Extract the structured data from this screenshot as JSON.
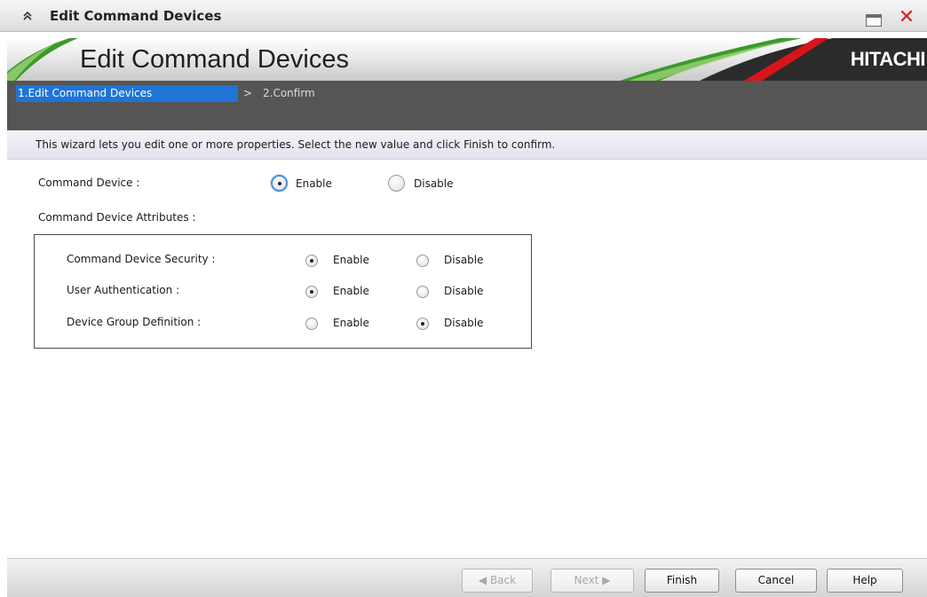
{
  "window": {
    "title": "Edit Command Devices"
  },
  "banner": {
    "title": "Edit Command Devices",
    "logo": "HITACHI"
  },
  "steps": {
    "current": "1.Edit Command Devices",
    "separator": ">",
    "next": "2.Confirm"
  },
  "description": "This wizard lets you edit one or more properties. Select the new value and click Finish to confirm.",
  "command_device": {
    "label": "Command Device :",
    "enable_label": "Enable",
    "disable_label": "Disable",
    "selected": "Enable"
  },
  "attributes": {
    "label": "Command Device Attributes :",
    "rows": [
      {
        "label": "Command Device Security :",
        "enable_label": "Enable",
        "disable_label": "Disable",
        "selected": "Enable"
      },
      {
        "label": "User Authentication :",
        "enable_label": "Enable",
        "disable_label": "Disable",
        "selected": "Enable"
      },
      {
        "label": "Device Group Definition :",
        "enable_label": "Enable",
        "disable_label": "Disable",
        "selected": "Disable"
      }
    ]
  },
  "footer": {
    "back_label": "Back",
    "next_label": "Next",
    "finish_label": "Finish",
    "cancel_label": "Cancel",
    "help_label": "Help"
  },
  "icons": {
    "collapse": "double-chevron-up-icon",
    "maximize": "maximize-icon",
    "close": "close-icon"
  },
  "colors": {
    "step_active": "#1f74d6",
    "step_bar": "#555555",
    "close": "#d42020",
    "banner_green": "#3b9a2c",
    "banner_red": "#d8141b"
  }
}
